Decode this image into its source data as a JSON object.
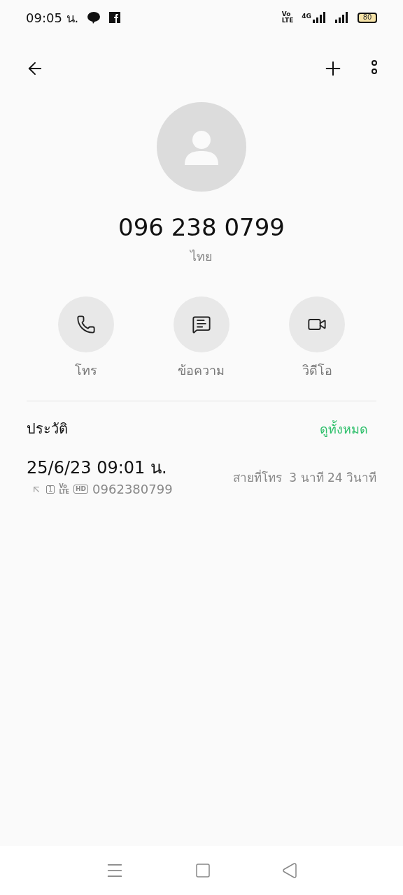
{
  "status_bar": {
    "time": "09:05 น.",
    "volte": [
      "Vo",
      "LTE"
    ],
    "network": "4G",
    "battery": "80"
  },
  "contact": {
    "number": "096 238 0799",
    "location": "ไทย"
  },
  "actions": [
    {
      "kind": "call",
      "label": "โทร"
    },
    {
      "kind": "message",
      "label": "ข้อความ"
    },
    {
      "kind": "video",
      "label": "วิดีโอ"
    }
  ],
  "history": {
    "title": "ประวัติ",
    "see_all": "ดูทั้งหมด",
    "entries": [
      {
        "datetime": "25/6/23 09:01 น.",
        "sim": "1",
        "volte": [
          "Vo",
          "LTE"
        ],
        "hd": "HD",
        "number": "0962380799",
        "duration": "สายที่โทร  3 นาที 24 วินาที"
      }
    ]
  }
}
